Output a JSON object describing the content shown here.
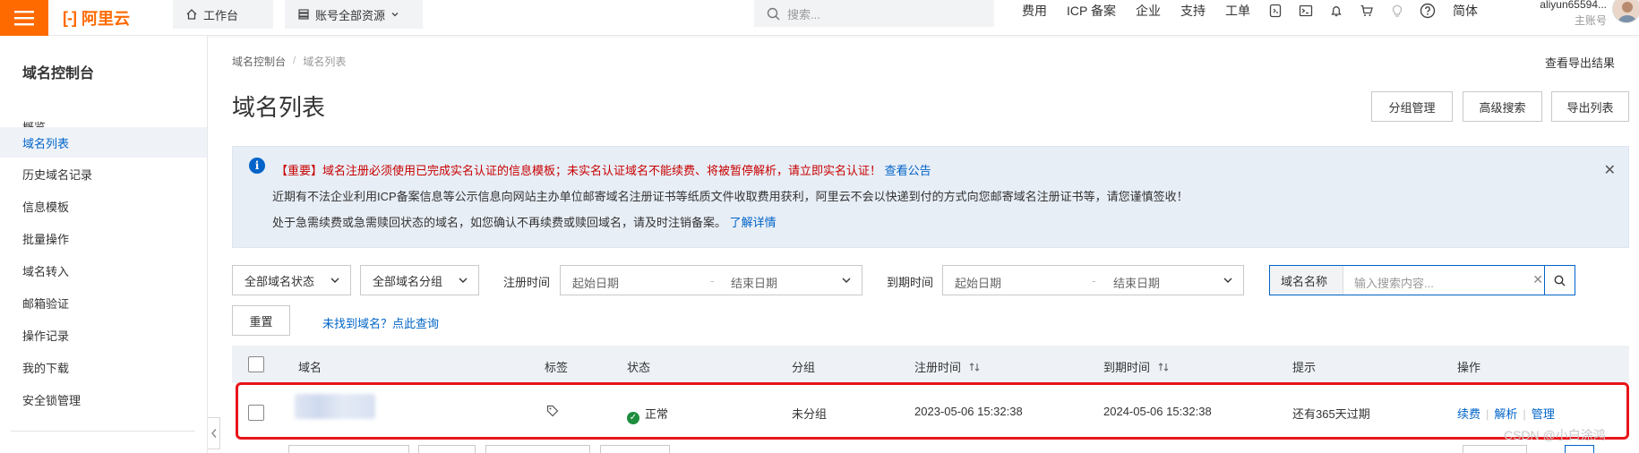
{
  "topbar": {
    "logo": "阿里云",
    "workbench": "工作台",
    "resources": "账号全部资源",
    "search_placeholder": "搜索...",
    "links": [
      "费用",
      "ICP 备案",
      "企业",
      "支持",
      "工单"
    ],
    "lang": "简体",
    "user_name": "aliyun65594...",
    "user_role": "主账号"
  },
  "sidebar": {
    "title": "域名控制台",
    "items": [
      {
        "label": "概览"
      },
      {
        "label": "域名列表"
      },
      {
        "label": "历史域名记录"
      },
      {
        "label": "信息模板"
      },
      {
        "label": "批量操作"
      },
      {
        "label": "域名转入"
      },
      {
        "label": "邮箱验证"
      },
      {
        "label": "操作记录"
      },
      {
        "label": "我的下载"
      },
      {
        "label": "安全锁管理"
      }
    ]
  },
  "main": {
    "breadcrumb": [
      "域名控制台",
      "域名列表"
    ],
    "export_result": "查看导出结果",
    "title": "域名列表",
    "buttons": {
      "group": "分组管理",
      "advanced": "高级搜索",
      "export": "导出列表"
    },
    "notice": {
      "line1": "【重要】域名注册必须使用已完成实名认证的信息模板；未实名认证域名不能续费、将被暂停解析，请立即实名认证！",
      "line1_link": "查看公告",
      "line2": "近期有不法企业利用ICP备案信息等公示信息向网站主办单位邮寄域名注册证书等纸质文件收取费用获利，阿里云不会以快递到付的方式向您邮寄域名注册证书等，请您谨慎签收！",
      "line3": "处于急需续费或急需赎回状态的域名，如您确认不再续费或赎回域名，请及时注销备案。",
      "line3_link": "了解详情"
    },
    "filters": {
      "status": "全部域名状态",
      "group": "全部域名分组",
      "reg_label": "注册时间",
      "exp_label": "到期时间",
      "start_ph": "起始日期",
      "end_ph": "结束日期",
      "search_label": "域名名称",
      "search_ph": "输入搜索内容...",
      "reset": "重置",
      "not_found": "未找到域名？点此查询"
    },
    "table": {
      "headers": [
        "域名",
        "标签",
        "状态",
        "分组",
        "注册时间",
        "到期时间",
        "提示",
        "操作"
      ],
      "rows": [
        {
          "status": "正常",
          "group": "未分组",
          "reg": "2023-05-06 15:32:38",
          "exp": "2024-05-06 15:32:38",
          "hint": "还有365天过期",
          "ops": [
            "续费",
            "解析",
            "管理"
          ]
        }
      ]
    },
    "watermark": "CSDN @小白涂鸿"
  }
}
